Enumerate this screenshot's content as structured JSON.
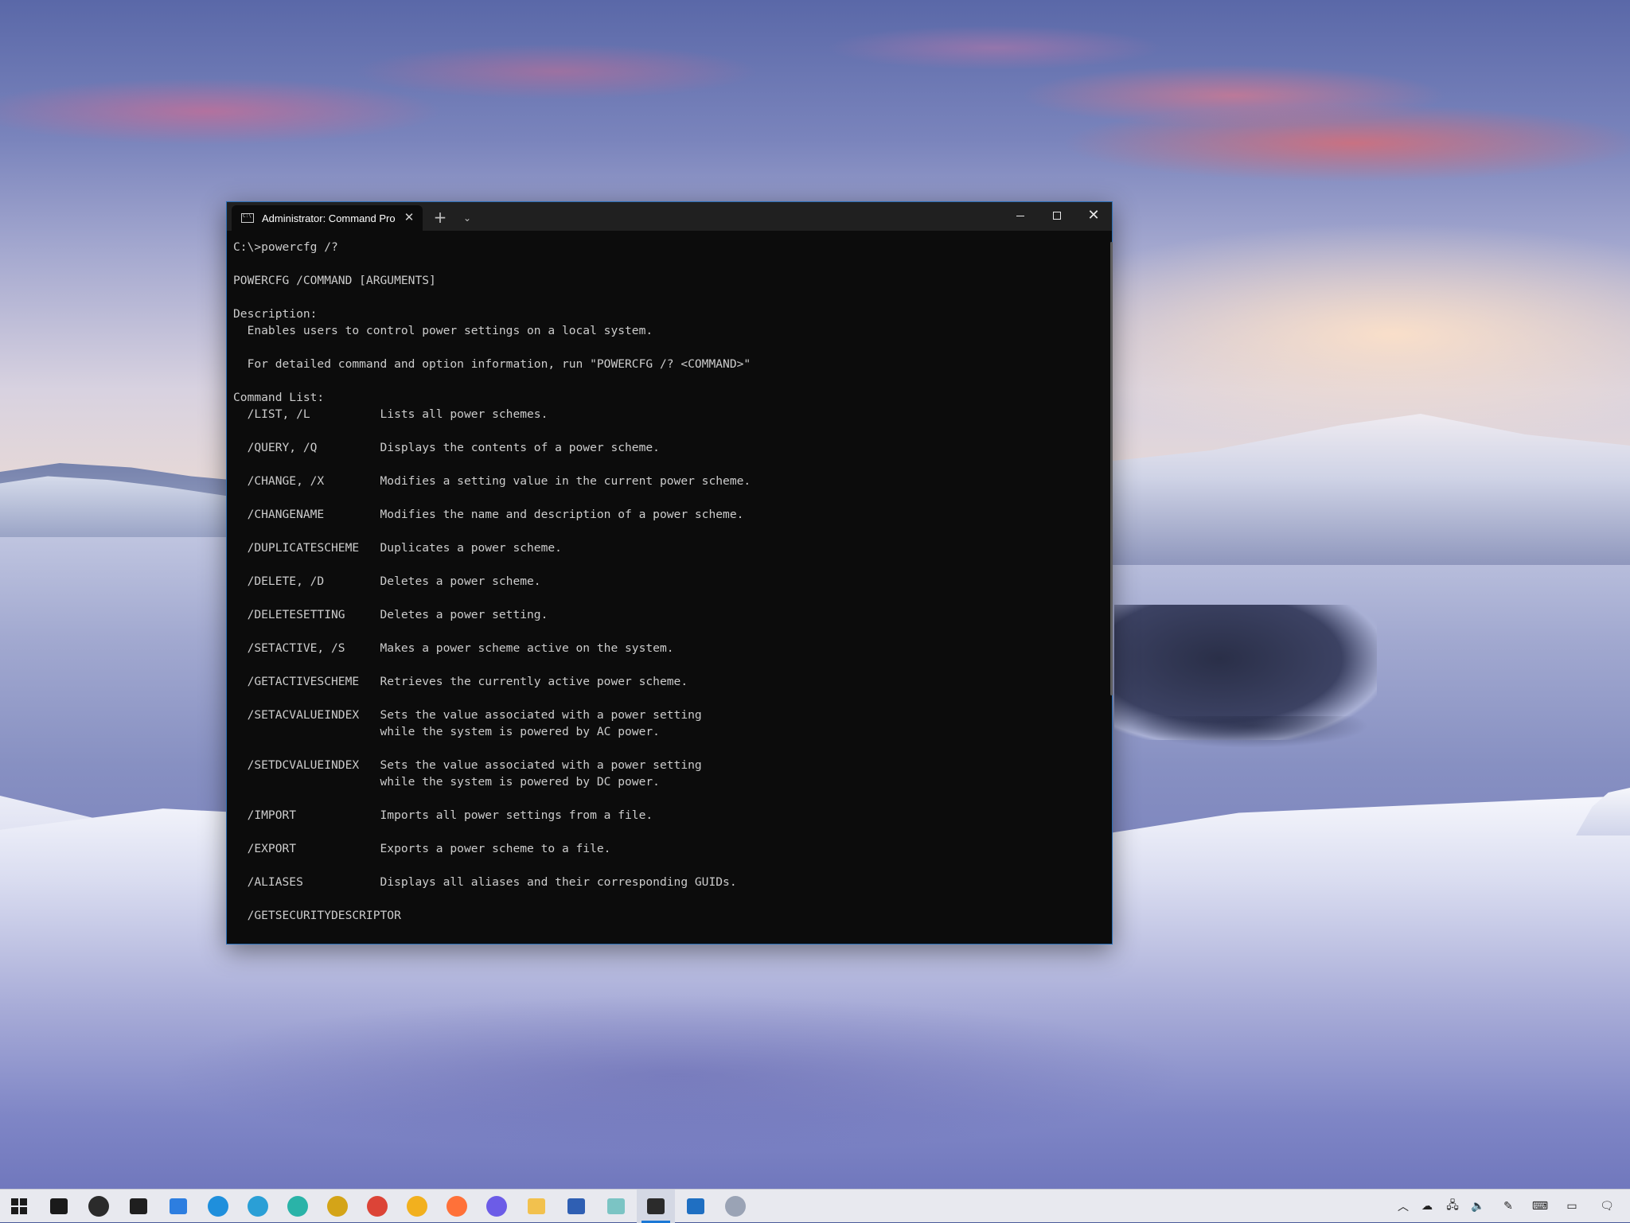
{
  "window": {
    "tab_title": "Administrator: Command Prompt",
    "new_tab_glyph": "+",
    "dropdown_glyph": "⌄",
    "close_tab_glyph": "✕",
    "close_glyph": "✕"
  },
  "console_lines": [
    "C:\\>powercfg /?",
    "",
    "POWERCFG /COMMAND [ARGUMENTS]",
    "",
    "Description:",
    "  Enables users to control power settings on a local system.",
    "",
    "  For detailed command and option information, run \"POWERCFG /? <COMMAND>\"",
    "",
    "Command List:",
    "  /LIST, /L          Lists all power schemes.",
    "",
    "  /QUERY, /Q         Displays the contents of a power scheme.",
    "",
    "  /CHANGE, /X        Modifies a setting value in the current power scheme.",
    "",
    "  /CHANGENAME        Modifies the name and description of a power scheme.",
    "",
    "  /DUPLICATESCHEME   Duplicates a power scheme.",
    "",
    "  /DELETE, /D        Deletes a power scheme.",
    "",
    "  /DELETESETTING     Deletes a power setting.",
    "",
    "  /SETACTIVE, /S     Makes a power scheme active on the system.",
    "",
    "  /GETACTIVESCHEME   Retrieves the currently active power scheme.",
    "",
    "  /SETACVALUEINDEX   Sets the value associated with a power setting",
    "                     while the system is powered by AC power.",
    "",
    "  /SETDCVALUEINDEX   Sets the value associated with a power setting",
    "                     while the system is powered by DC power.",
    "",
    "  /IMPORT            Imports all power settings from a file.",
    "",
    "  /EXPORT            Exports a power scheme to a file.",
    "",
    "  /ALIASES           Displays all aliases and their corresponding GUIDs.",
    "",
    "  /GETSECURITYDESCRIPTOR"
  ],
  "taskbar": {
    "items": [
      {
        "name": "start-button",
        "icon": "windows-logo-icon",
        "color": "#1a1a1a"
      },
      {
        "name": "task-view-button",
        "icon": "task-view-icon",
        "color": "#1a1a1a"
      },
      {
        "name": "settings-app",
        "icon": "gear-icon",
        "color": "#2b2b2b"
      },
      {
        "name": "store-app",
        "icon": "store-bag-icon",
        "color": "#1f1f1f"
      },
      {
        "name": "phone-app",
        "icon": "phone-icon",
        "color": "#2d7ee0"
      },
      {
        "name": "edge-app",
        "icon": "edge-icon",
        "color": "#1f8fdc"
      },
      {
        "name": "edge-beta-app",
        "icon": "edge-beta-icon",
        "color": "#2a9fd6"
      },
      {
        "name": "edge-dev-app",
        "icon": "edge-dev-icon",
        "color": "#2ab3a8"
      },
      {
        "name": "edge-canary-app",
        "icon": "edge-canary-icon",
        "color": "#d4a418"
      },
      {
        "name": "chrome-app",
        "icon": "chrome-icon",
        "color": "#dc4437"
      },
      {
        "name": "chrome-canary-app",
        "icon": "chrome-canary-icon",
        "color": "#f2b01e"
      },
      {
        "name": "firefox-app",
        "icon": "firefox-icon",
        "color": "#ff7139"
      },
      {
        "name": "firefox-nightly-app",
        "icon": "firefox-nightly-icon",
        "color": "#6c5ce7"
      },
      {
        "name": "file-explorer-app",
        "icon": "folder-icon",
        "color": "#f2c14e"
      },
      {
        "name": "powershell-app",
        "icon": "powershell-icon",
        "color": "#2f5fb3"
      },
      {
        "name": "notepad-app",
        "icon": "notepad-icon",
        "color": "#7bc4c4"
      },
      {
        "name": "terminal-app",
        "icon": "terminal-icon",
        "color": "#2b2b2b",
        "active": true
      },
      {
        "name": "photos-app",
        "icon": "photos-icon",
        "color": "#1f6fc2"
      },
      {
        "name": "cloud-app",
        "icon": "cloud-drive-icon",
        "color": "#9aa3b5"
      }
    ],
    "tray": [
      {
        "name": "show-hidden-icons-button",
        "icon": "chevron-up-icon",
        "glyph": "︿"
      },
      {
        "name": "onedrive-tray",
        "icon": "cloud-icon",
        "glyph": "☁"
      },
      {
        "name": "network-tray",
        "icon": "network-icon",
        "glyph": "🖧"
      },
      {
        "name": "volume-tray",
        "icon": "speaker-icon",
        "glyph": "🔈"
      },
      {
        "name": "pen-tray",
        "icon": "pen-icon",
        "glyph": "✎"
      },
      {
        "name": "touch-keyboard-tray",
        "icon": "keyboard-icon",
        "glyph": "⌨"
      },
      {
        "name": "desktop-tray",
        "icon": "desktop-icon",
        "glyph": "▭"
      },
      {
        "name": "action-center-button",
        "icon": "notification-icon",
        "glyph": "🗨"
      }
    ]
  }
}
